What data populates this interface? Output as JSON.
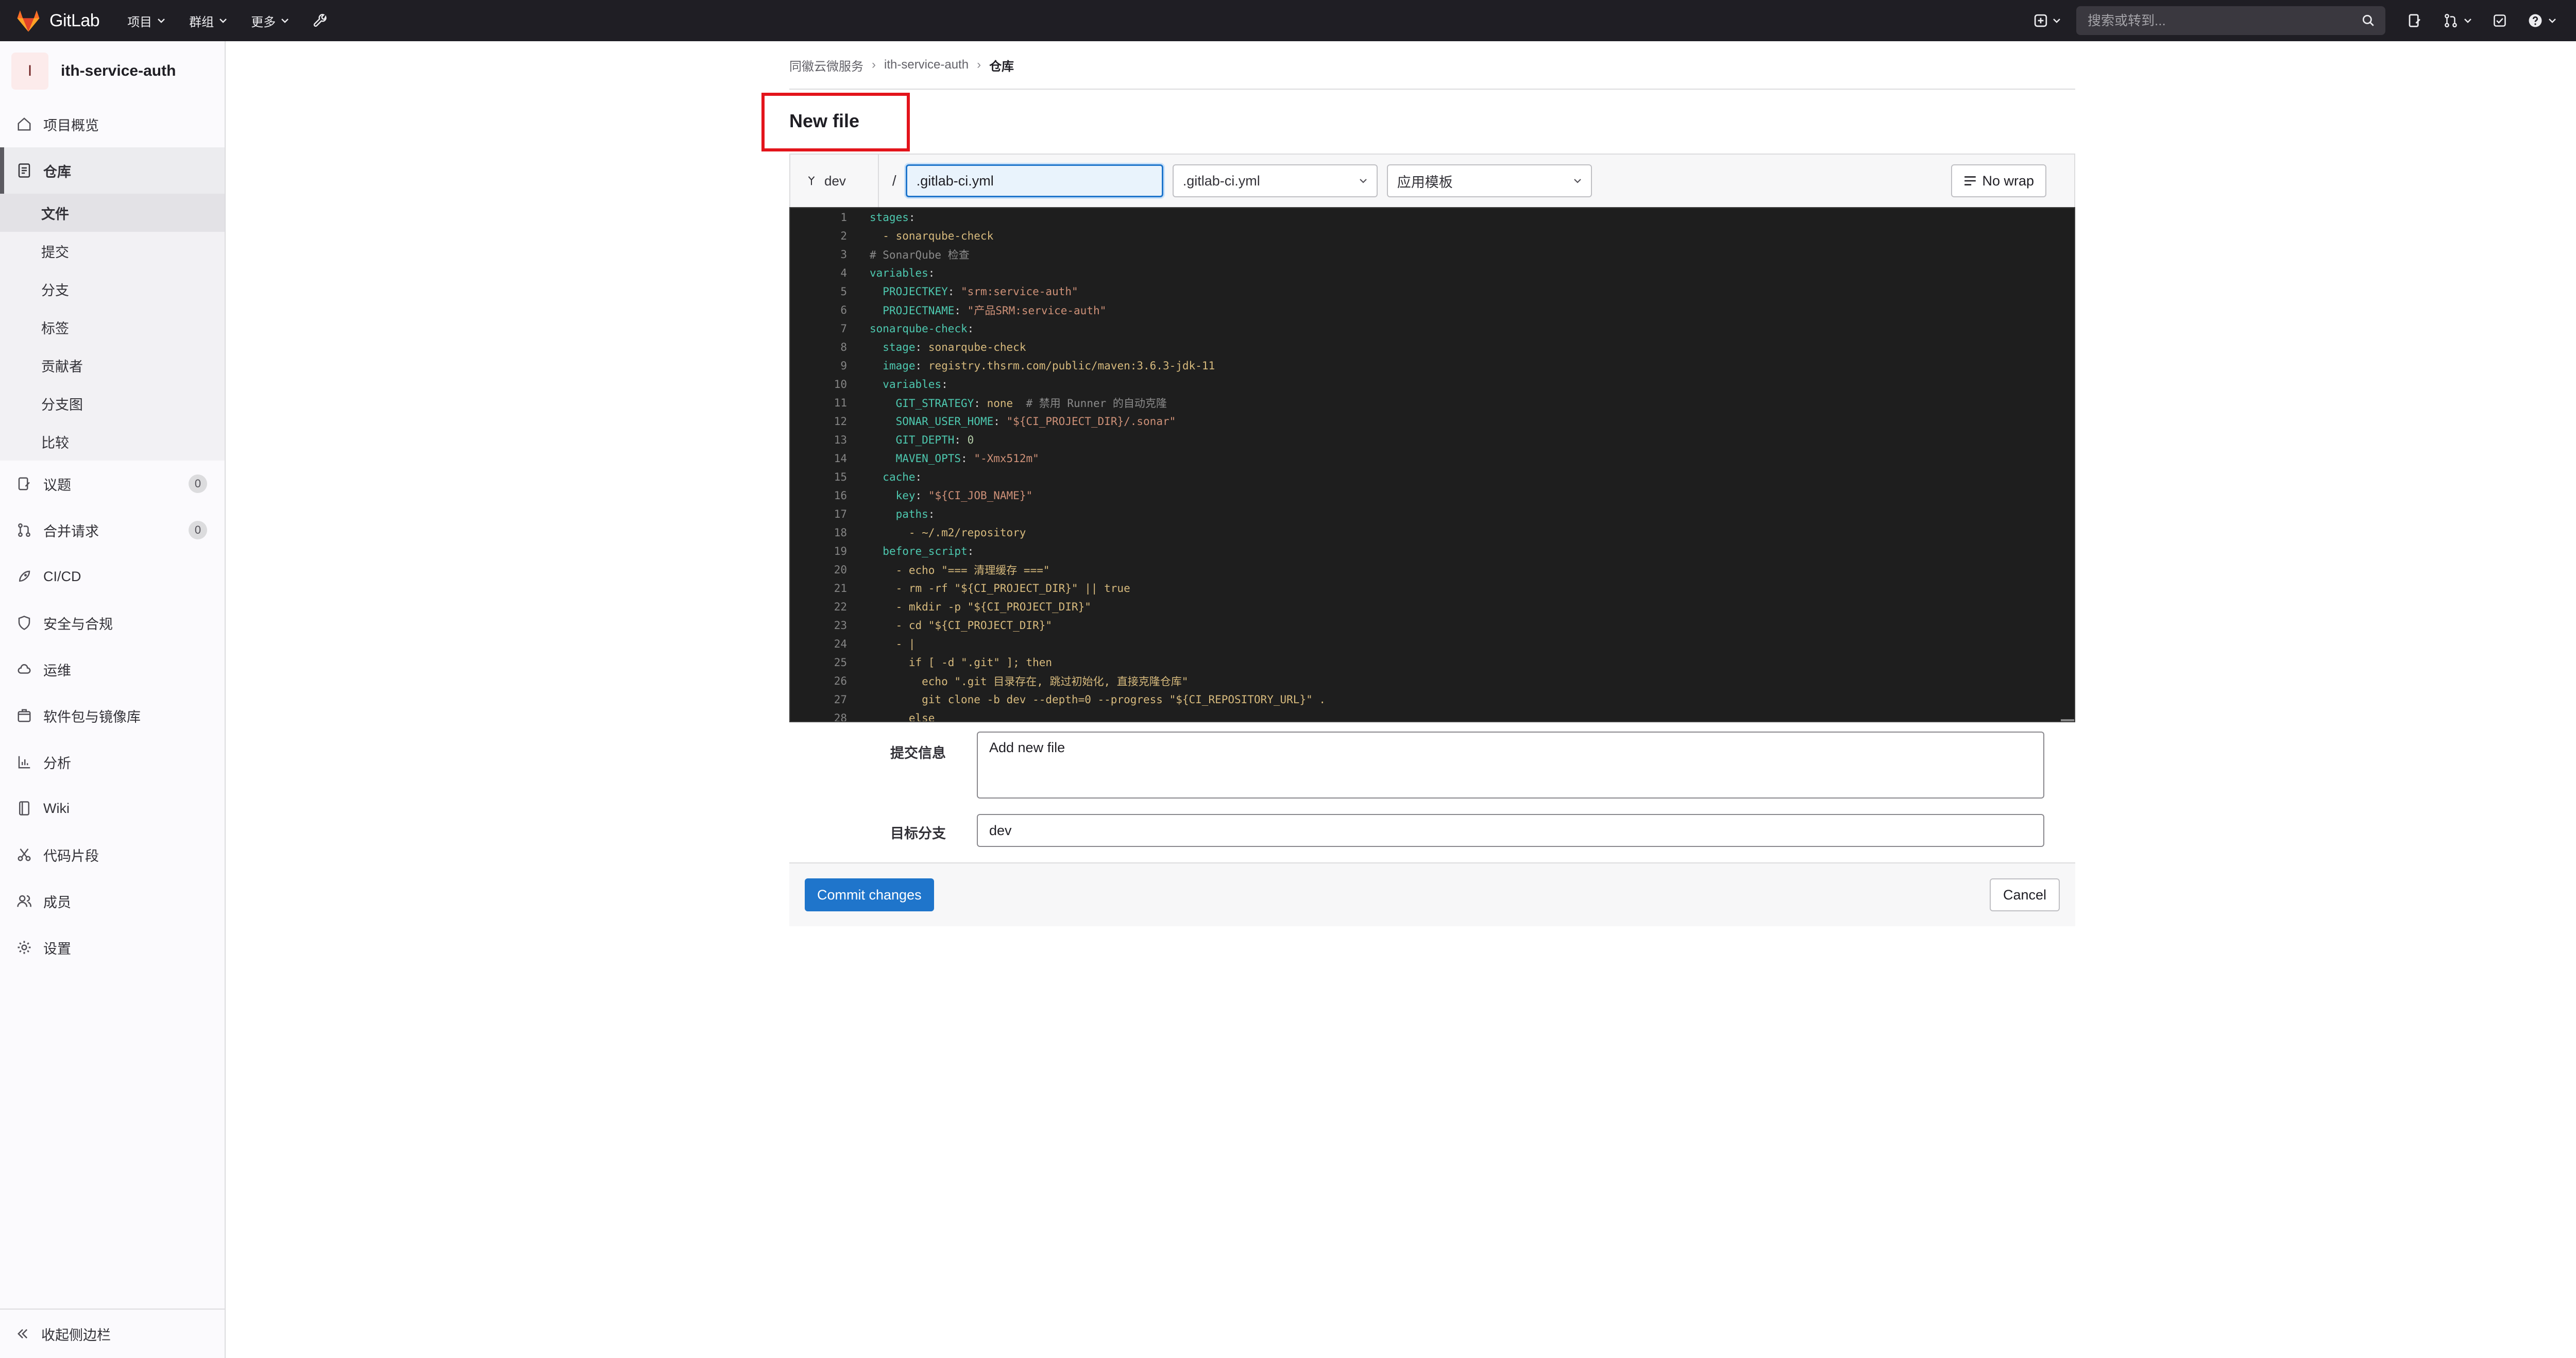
{
  "topbar": {
    "brand": "GitLab",
    "nav": [
      "项目",
      "群组",
      "更多"
    ],
    "search_placeholder": "搜索或转到..."
  },
  "sidebar": {
    "project_initial": "I",
    "project_name": "ith-service-auth",
    "items": {
      "overview": "项目概览",
      "repository": "仓库",
      "issues": "议题",
      "issues_count": "0",
      "merge_requests": "合并请求",
      "mr_count": "0",
      "cicd": "CI/CD",
      "security": "安全与合规",
      "ops": "运维",
      "packages": "软件包与镜像库",
      "analytics": "分析",
      "wiki": "Wiki",
      "snippets": "代码片段",
      "members": "成员",
      "settings": "设置"
    },
    "repo_sub": [
      "文件",
      "提交",
      "分支",
      "标签",
      "贡献者",
      "分支图",
      "比较"
    ],
    "collapse": "收起侧边栏"
  },
  "breadcrumb": [
    "同徽云微服务",
    "ith-service-auth",
    "仓库"
  ],
  "page_title": "New file",
  "file_header": {
    "branch": "dev",
    "slash": "/",
    "file_name": ".gitlab-ci.yml",
    "template_type": ".gitlab-ci.yml",
    "template": "应用模板",
    "no_wrap": "No wrap"
  },
  "code_lines": [
    "stages:",
    "  - sonarqube-check",
    "# SonarQube 检查",
    "variables:",
    "  PROJECTKEY: \"srm:service-auth\"",
    "  PROJECTNAME: \"产品SRM:service-auth\"",
    "sonarqube-check:",
    "  stage: sonarqube-check",
    "  image: registry.thsrm.com/public/maven:3.6.3-jdk-11",
    "  variables:",
    "    GIT_STRATEGY: none  # 禁用 Runner 的自动克隆",
    "    SONAR_USER_HOME: \"${CI_PROJECT_DIR}/.sonar\"",
    "    GIT_DEPTH: 0",
    "    MAVEN_OPTS: \"-Xmx512m\"",
    "  cache:",
    "    key: \"${CI_JOB_NAME}\"",
    "    paths:",
    "      - ~/.m2/repository",
    "  before_script:",
    "    - echo \"=== 清理缓存 ===\"",
    "    - rm -rf \"${CI_PROJECT_DIR}\" || true",
    "    - mkdir -p \"${CI_PROJECT_DIR}\"",
    "    - cd \"${CI_PROJECT_DIR}\"",
    "    - |",
    "      if [ -d \".git\" ]; then",
    "        echo \".git 目录存在, 跳过初始化, 直接克隆仓库\"",
    "        git clone -b dev --depth=0 --progress \"${CI_REPOSITORY_URL}\" .",
    "      else"
  ],
  "commit": {
    "message_label": "提交信息",
    "message": "Add new file",
    "branch_label": "目标分支",
    "branch": "dev",
    "commit_btn": "Commit changes",
    "cancel_btn": "Cancel"
  },
  "colors": {
    "topbar": "#1f1e24",
    "primary": "#1f75cb",
    "highlight": "#e3141b",
    "editor_bg": "#1e1e1e"
  }
}
